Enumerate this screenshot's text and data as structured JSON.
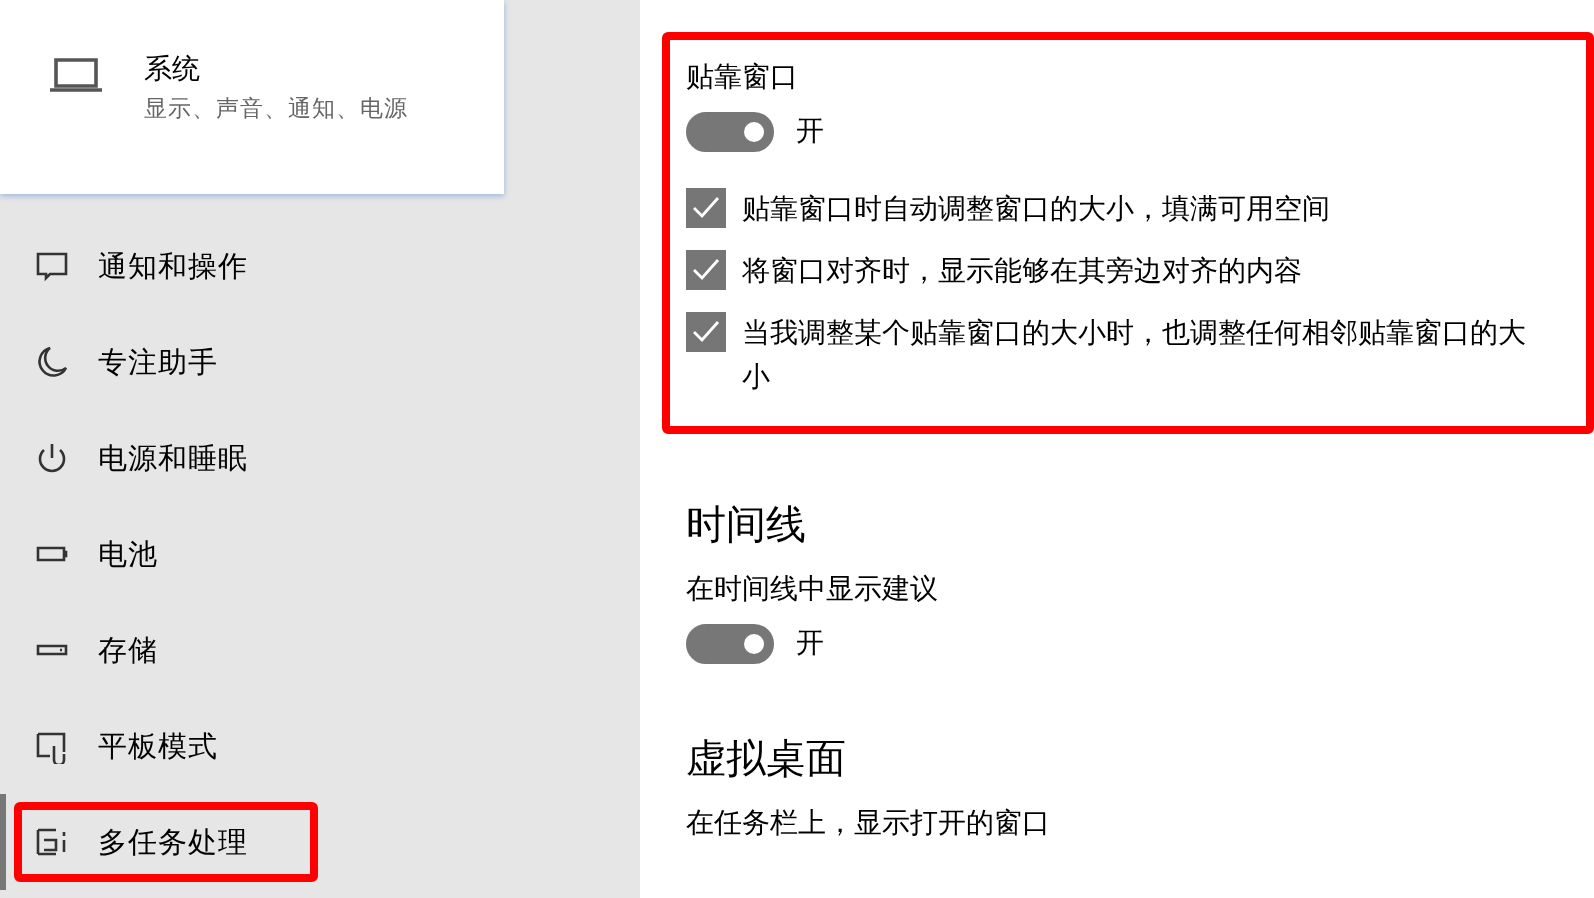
{
  "nav_card": {
    "title": "系统",
    "subtitle": "显示、声音、通知、电源"
  },
  "sidebar": {
    "items": [
      {
        "label": "通知和操作",
        "selected": false,
        "highlighted": false
      },
      {
        "label": "专注助手",
        "selected": false,
        "highlighted": false
      },
      {
        "label": "电源和睡眠",
        "selected": false,
        "highlighted": false
      },
      {
        "label": "电池",
        "selected": false,
        "highlighted": false
      },
      {
        "label": "存储",
        "selected": false,
        "highlighted": false
      },
      {
        "label": "平板模式",
        "selected": false,
        "highlighted": false
      },
      {
        "label": "多任务处理",
        "selected": true,
        "highlighted": true
      }
    ]
  },
  "sections": [
    {
      "highlighted": true,
      "items": [
        {
          "kind": "toggle",
          "label": "贴靠窗口",
          "on": true,
          "state_text": "开"
        },
        {
          "kind": "checkbox",
          "label": "贴靠窗口时自动调整窗口的大小，填满可用空间",
          "checked": true
        },
        {
          "kind": "checkbox",
          "label": "将窗口对齐时，显示能够在其旁边对齐的内容",
          "checked": true
        },
        {
          "kind": "checkbox",
          "label": "当我调整某个贴靠窗口的大小时，也调整任何相邻贴靠窗口的大小",
          "checked": true
        }
      ]
    },
    {
      "heading": "时间线",
      "items": [
        {
          "kind": "toggle",
          "label": "在时间线中显示建议",
          "on": true,
          "state_text": "开"
        }
      ]
    },
    {
      "heading": "虚拟桌面",
      "items": [
        {
          "kind": "text",
          "label": "在任务栏上，显示打开的窗口"
        }
      ]
    }
  ]
}
